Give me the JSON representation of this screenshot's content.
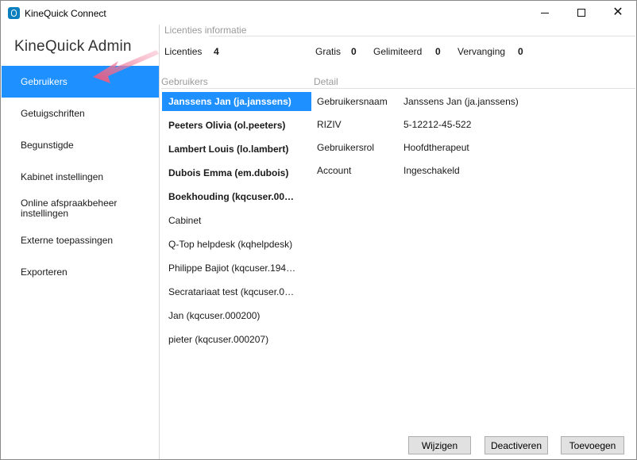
{
  "window": {
    "title": "KineQuick Connect",
    "controls": {
      "minimize": "—",
      "maximize": "☐",
      "close": "✕"
    }
  },
  "sidebar": {
    "title": "KineQuick Admin",
    "items": [
      {
        "label": "Gebruikers",
        "active": true
      },
      {
        "label": "Getuigschriften"
      },
      {
        "label": "Begunstigde"
      },
      {
        "label": "Kabinet instellingen"
      },
      {
        "label": "Online afspraakbeheer instellingen"
      },
      {
        "label": "Externe toepassingen"
      },
      {
        "label": "Exporteren"
      }
    ]
  },
  "licenses": {
    "section_label": "Licenties informatie",
    "items": [
      {
        "label": "Licenties",
        "value": "4"
      },
      {
        "label": "Gratis",
        "value": "0"
      },
      {
        "label": "Gelimiteerd",
        "value": "0"
      },
      {
        "label": "Vervanging",
        "value": "0"
      }
    ]
  },
  "users": {
    "section_label": "Gebruikers",
    "list": [
      {
        "name": "Janssens Jan (ja.janssens)",
        "bold": true,
        "selected": true
      },
      {
        "name": "Peeters Olivia (ol.peeters)",
        "bold": true
      },
      {
        "name": "Lambert Louis (lo.lambert)",
        "bold": true
      },
      {
        "name": "Dubois Emma (em.dubois)",
        "bold": true
      },
      {
        "name": "Boekhouding (kqcuser.00…",
        "bold": true
      },
      {
        "name": "Cabinet"
      },
      {
        "name": "Q-Top helpdesk (kqhelpdesk)"
      },
      {
        "name": "Philippe Bajiot (kqcuser.194…"
      },
      {
        "name": "Secratariaat test (kqcuser.0…"
      },
      {
        "name": "Jan (kqcuser.000200)"
      },
      {
        "name": "pieter (kqcuser.000207)"
      }
    ]
  },
  "detail": {
    "section_label": "Detail",
    "rows": [
      {
        "key": "Gebruikersnaam",
        "value": "Janssens Jan (ja.janssens)"
      },
      {
        "key": "RIZIV",
        "value": "5-12212-45-522"
      },
      {
        "key": "Gebruikersrol",
        "value": "Hoofdtherapeut"
      },
      {
        "key": "Account",
        "value": "Ingeschakeld"
      }
    ]
  },
  "buttons": {
    "edit": "Wijzigen",
    "deactivate": "Deactiveren",
    "add": "Toevoegen"
  },
  "colors": {
    "accent": "#1e90ff",
    "annotation_arrow": "#e8527a",
    "app_icon": "#0a7fc0"
  }
}
